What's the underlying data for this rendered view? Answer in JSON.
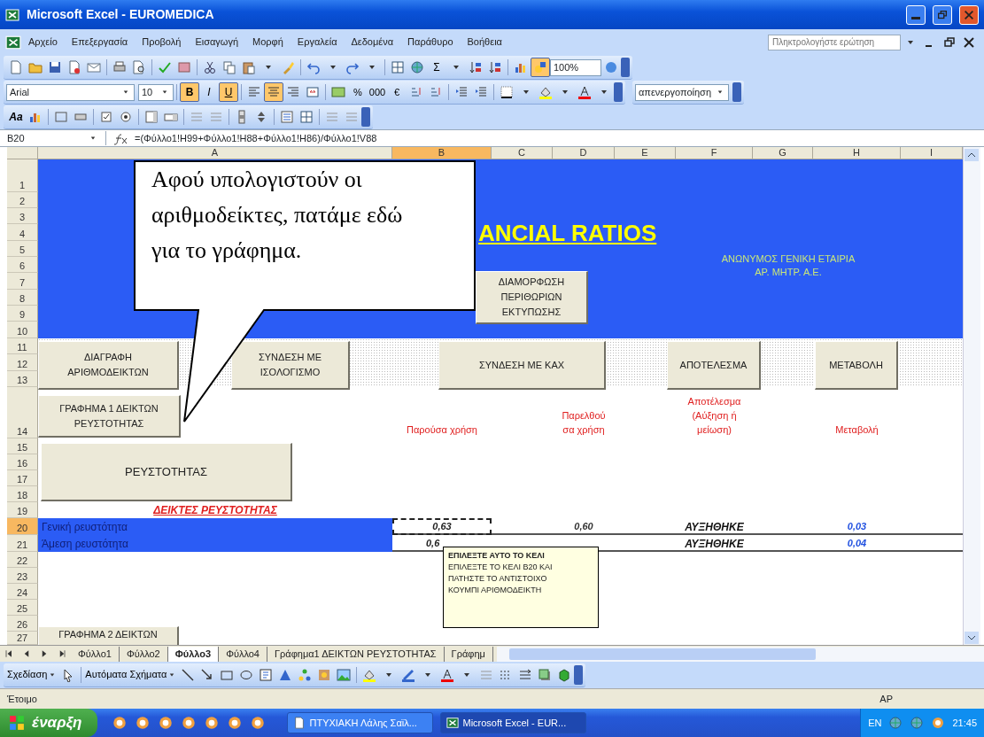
{
  "window": {
    "title": "Microsoft Excel - EUROMEDICA"
  },
  "menu": [
    "Αρχείο",
    "Επεξεργασία",
    "Προβολή",
    "Εισαγωγή",
    "Μορφή",
    "Εργαλεία",
    "Δεδομένα",
    "Παράθυρο",
    "Βοήθεια"
  ],
  "help_box": {
    "placeholder": "Πληκτρολογήστε ερώτηση"
  },
  "standard_toolbar": {
    "sum": "Σ",
    "zoom": "100%",
    "drawing_pressed": true
  },
  "formatting_toolbar": {
    "font": "Arial",
    "size": "10",
    "styles": [
      {
        "label": "B",
        "pressed": true
      },
      {
        "label": "I",
        "pressed": false
      },
      {
        "label": "U",
        "pressed": true
      }
    ],
    "align": [
      {
        "pressed": false
      },
      {
        "pressed": true
      },
      {
        "pressed": false
      },
      {
        "pressed": false
      }
    ],
    "number_symbols": [
      "%",
      "000",
      "€"
    ]
  },
  "protect_toolbar": {
    "value": "απενεργοποίηση"
  },
  "forms_toolbar": {
    "label_tool": "Aa"
  },
  "formula_bar": {
    "name_box": "B20",
    "formula": "=(Φύλλο1!H99+Φύλλο1!H88+Φύλλο1!H86)/Φύλλο1!V88"
  },
  "sheet": {
    "columns": [
      {
        "label": "A",
        "selected": false
      },
      {
        "label": "B",
        "selected": true
      },
      {
        "label": "C",
        "selected": false
      },
      {
        "label": "D",
        "selected": false
      },
      {
        "label": "E",
        "selected": false
      },
      {
        "label": "F",
        "selected": false
      },
      {
        "label": "G",
        "selected": false
      },
      {
        "label": "H",
        "selected": false
      },
      {
        "label": "I",
        "selected": false
      }
    ],
    "rows": [
      {
        "label": "1",
        "selected": false
      },
      {
        "label": "2",
        "selected": false
      },
      {
        "label": "3",
        "selected": false
      },
      {
        "label": "4",
        "selected": false
      },
      {
        "label": "5",
        "selected": false
      },
      {
        "label": "6",
        "selected": false
      },
      {
        "label": "7",
        "selected": false
      },
      {
        "label": "8",
        "selected": false
      },
      {
        "label": "9",
        "selected": false
      },
      {
        "label": "10",
        "selected": false
      },
      {
        "label": "11",
        "selected": false
      },
      {
        "label": "12",
        "selected": false
      },
      {
        "label": "13",
        "selected": false
      },
      {
        "label": "14",
        "selected": false
      },
      {
        "label": "15",
        "selected": false
      },
      {
        "label": "16",
        "selected": false
      },
      {
        "label": "17",
        "selected": false
      },
      {
        "label": "18",
        "selected": false
      },
      {
        "label": "19",
        "selected": false
      },
      {
        "label": "20",
        "selected": true
      },
      {
        "label": "21",
        "selected": false
      },
      {
        "label": "22",
        "selected": false
      },
      {
        "label": "23",
        "selected": false
      },
      {
        "label": "24",
        "selected": false
      },
      {
        "label": "25",
        "selected": false
      },
      {
        "label": "26",
        "selected": false
      },
      {
        "label": "27",
        "selected": false
      }
    ],
    "title": "ANCIAL RATIOS",
    "company": [
      "ΑΝΩΝΥΜΟΣ ΓΕΝΙΚΗ ΕΤΑΙΡΙΑ",
      "ΑΡ. ΜΗΤΡ. Α.Ε."
    ],
    "buttons": [
      {
        "label": "ΔΙΑΜΟΡΦΩΣΗ ΠΕΡΙΘΩΡΙΩΝ ΕΚΤΥΠΩΣΗΣ"
      },
      {
        "label": "ΔΙΑΓΡΑΦΗ ΑΡΙΘΜΟΔΕΙΚΤΩΝ"
      },
      {
        "label": "ΣΥΝΔΕΣΗ ΜΕ ΙΣΟΛΟΓΙΣΜΟ"
      },
      {
        "label": "ΣΥΝΔΕΣΗ ΜΕ ΚΑΧ"
      },
      {
        "label": "ΑΠΟΤΕΛΕΣΜΑ"
      },
      {
        "label": "ΜΕΤΑΒΟΛΗ"
      },
      {
        "label": "ΓΡΑΦΗΜΑ 1 ΔΕΙΚΤΩΝ ΡΕΥΣΤΟΤΗΤΑΣ"
      },
      {
        "label": "ΡΕΥΣΤΟΤΗΤΑΣ"
      },
      {
        "label": "ΓΡΑΦΗΜΑ 2 ΔΕΙΚΤΩΝ"
      }
    ],
    "headers": [
      "Παρούσα χρήση",
      "Παρελθού σα χρήση",
      "Αποτέλεσμα (Αύξηση ή μείωση)",
      "Μεταβολή"
    ],
    "section": "ΔΕΙΚΤΕΣ ΡΕΥΣΤΟΤΗΤΑΣ",
    "data_rows": [
      {
        "label": "Γενική ρευστότητα",
        "current": "0,63",
        "current_selected": true,
        "previous": "0,60",
        "result": "ΑΥΞΗΘΗΚΕ",
        "change": "0,03"
      },
      {
        "label": "Άμεση ρευστότητα",
        "current": "0,6",
        "current_selected": false,
        "result": "ΑΥΞΗΘΗΚΕ",
        "change": "0,04"
      }
    ]
  },
  "callout": {
    "text": "Αφού υπολογιστούν οι αριθμοδείκτες, πατάμε εδώ για το γράφημα."
  },
  "comment": {
    "title": "ΕΠΙΛΕΞΤΕ ΑΥΤΟ ΤΟ ΚΕΛΙ",
    "text": "ΕΠΙΛΕΞΤΕ ΤΟ ΚΕΛΙ B20 ΚΑΙ ΠΑΤΗΣΤΕ ΤΟ ΑΝΤΙΣΤΟΙΧΟ ΚΟΥΜΠΙ ΑΡΙΘΜΟΔΕΙΚΤΗ"
  },
  "sheet_tabs": [
    {
      "label": "Φύλλο1",
      "selected": false
    },
    {
      "label": "Φύλλο2",
      "selected": false
    },
    {
      "label": "Φύλλο3",
      "selected": true
    },
    {
      "label": "Φύλλο4",
      "selected": false
    },
    {
      "label": "Γράφημα1 ΔΕΙΚΤΩΝ ΡΕΥΣΤΟΤΗΤΑΣ",
      "selected": false
    },
    {
      "label": "Γράφημ",
      "selected": false
    }
  ],
  "drawing_toolbar": {
    "draw": "Σχεδίαση",
    "autoshapes": "Αυτόματα Σχήματα"
  },
  "status_bar": {
    "left": "Έτοιμο",
    "right": "ΑΡ"
  },
  "taskbar": {
    "start": "έναρξη",
    "tasks": [
      {
        "label": "ΠΤΥΧΙΑΚΗ Λάλης Σαϊλ...",
        "selected": false
      },
      {
        "label": "Microsoft Excel - EUR...",
        "selected": true
      }
    ],
    "language": "EN",
    "time": "21:45"
  }
}
